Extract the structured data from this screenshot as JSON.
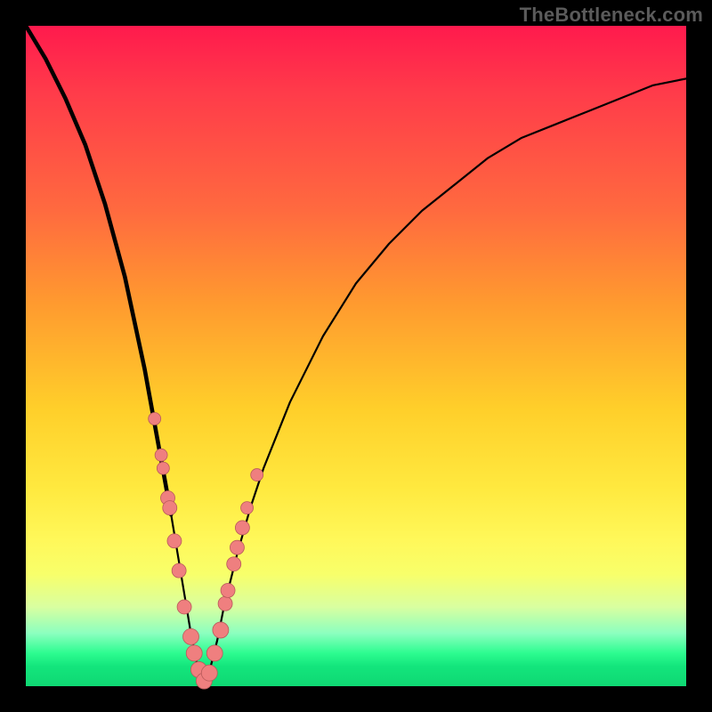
{
  "watermark": "TheBottleneck.com",
  "chart_data": {
    "type": "line",
    "title": "",
    "xlabel": "",
    "ylabel": "",
    "xlim": [
      0,
      100
    ],
    "ylim": [
      0,
      100
    ],
    "grid": false,
    "legend": false,
    "description": "Bottleneck-percentage V-curve over a red→green vertical gradient background. The black curve descends steeply from the top-left, reaches ≈0% near x≈27, then rises with diminishing slope toward the right. Salmon dots mark sampled hardware pairings clustered near the trough and lower flanks.",
    "series": [
      {
        "name": "bottleneck_curve",
        "x": [
          0,
          3,
          6,
          9,
          12,
          15,
          18,
          20,
          22,
          24,
          25,
          26,
          27,
          28,
          29,
          30,
          32,
          34,
          36,
          40,
          45,
          50,
          55,
          60,
          65,
          70,
          75,
          80,
          85,
          90,
          95,
          100
        ],
        "y": [
          100,
          95,
          89,
          82,
          73,
          62,
          48,
          37,
          26,
          14,
          8,
          3,
          0,
          3,
          7,
          12,
          20,
          27,
          33,
          43,
          53,
          61,
          67,
          72,
          76,
          80,
          83,
          85,
          87,
          89,
          91,
          92
        ]
      }
    ],
    "points": {
      "name": "hardware_samples",
      "x": [
        19.5,
        20.5,
        20.8,
        21.5,
        21.8,
        22.5,
        23.2,
        24.0,
        25.0,
        25.5,
        26.2,
        27.0,
        27.8,
        28.6,
        29.5,
        30.2,
        30.6,
        31.5,
        32.0,
        32.8,
        33.5,
        35.0
      ],
      "y": [
        40.5,
        35.0,
        33.0,
        28.5,
        27.0,
        22.0,
        17.5,
        12.0,
        7.5,
        5.0,
        2.5,
        0.8,
        2.0,
        5.0,
        8.5,
        12.5,
        14.5,
        18.5,
        21.0,
        24.0,
        27.0,
        32.0
      ]
    },
    "background_gradient": {
      "top_color": "#ff1a4d",
      "mid_color": "#ffe93f",
      "bottom_color": "#0fd873"
    }
  }
}
